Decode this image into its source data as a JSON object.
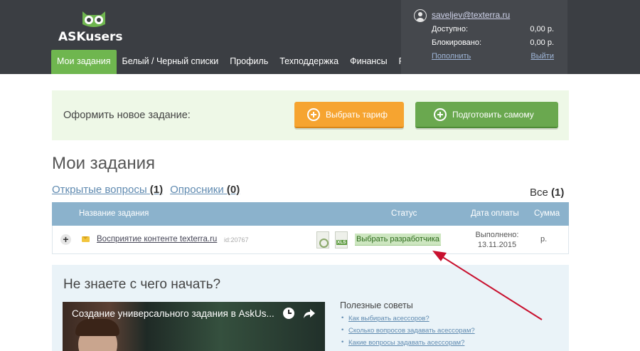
{
  "brand": {
    "logo_text": "ASKusers"
  },
  "nav": {
    "items": [
      {
        "label": "Мои задания",
        "active": true
      },
      {
        "label": "Белый / Черный списки",
        "active": false
      },
      {
        "label": "Профиль",
        "active": false
      },
      {
        "label": "Техподдержка",
        "active": false
      },
      {
        "label": "Финансы",
        "active": false
      },
      {
        "label": "FAQ",
        "active": false
      }
    ]
  },
  "account": {
    "email": "saveljev@texterra.ru",
    "available_label": "Доступно:",
    "available_value": "0,00 р.",
    "blocked_label": "Блокировано:",
    "blocked_value": "0,00 р.",
    "topup_link": "Пополнить",
    "logout_link": "Выйти"
  },
  "new_task": {
    "label": "Оформить новое задание:",
    "choose_plan_button": "Выбрать тариф",
    "prepare_self_button": "Подготовить самому"
  },
  "tasks": {
    "title": "Мои задания",
    "filters": [
      {
        "label": "Открытые вопросы",
        "count": "(1)"
      },
      {
        "label": "Опросники",
        "count": "(0)"
      }
    ],
    "all_label": "Все",
    "all_count": "(1)",
    "columns": {
      "name": "Название задания",
      "status": "Статус",
      "paid_date": "Дата оплаты",
      "sum": "Сумма"
    },
    "rows": [
      {
        "name": "Восприятие контенте texterra.ru",
        "id": "id:20767",
        "status": "Выбрать разработчика",
        "paid_line1": "Выполнено:",
        "paid_line2": "13.11.2015",
        "sum": "р."
      }
    ]
  },
  "help": {
    "title": "Не знаете с чего начать?",
    "video_title": "Создание универсального задания в AskUs...",
    "tips_title": "Полезные советы",
    "tips": [
      "Как выбирать асессоров?",
      "Сколько вопросов задавать асессорам?",
      "Какие вопросы задавать асессорам?"
    ]
  },
  "colors": {
    "header_bg": "#3b3e43",
    "nav_active": "#6fb64f",
    "btn_orange": "#f6a430",
    "btn_green": "#6aa84f",
    "table_head": "#8bb2cc",
    "annotation_arrow": "#c8102e"
  }
}
